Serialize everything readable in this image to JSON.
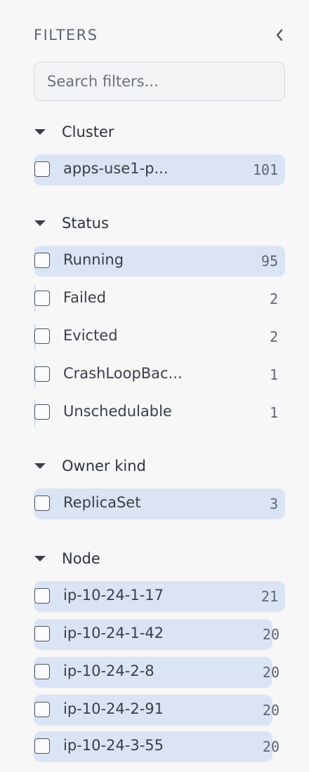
{
  "header": {
    "title": "FILTERS"
  },
  "search": {
    "placeholder": "Search filters..."
  },
  "sections": [
    {
      "title": "Cluster",
      "items": [
        {
          "label": "apps-use1-p...",
          "count": "101",
          "fill": 1.0
        }
      ]
    },
    {
      "title": "Status",
      "items": [
        {
          "label": "Running",
          "count": "95",
          "fill": 1.0
        },
        {
          "label": "Failed",
          "count": "2",
          "fill": 0.02
        },
        {
          "label": "Evicted",
          "count": "2",
          "fill": 0.02
        },
        {
          "label": "CrashLoopBac...",
          "count": "1",
          "fill": 0.01
        },
        {
          "label": "Unschedulable",
          "count": "1",
          "fill": 0.01
        }
      ]
    },
    {
      "title": "Owner kind",
      "items": [
        {
          "label": "ReplicaSet",
          "count": "3",
          "fill": 1.0
        }
      ]
    },
    {
      "title": "Node",
      "items": [
        {
          "label": "ip-10-24-1-17",
          "count": "21",
          "fill": 1.0
        },
        {
          "label": "ip-10-24-1-42",
          "count": "20",
          "fill": 0.95
        },
        {
          "label": "ip-10-24-2-8",
          "count": "20",
          "fill": 0.95
        },
        {
          "label": "ip-10-24-2-91",
          "count": "20",
          "fill": 0.95
        },
        {
          "label": "ip-10-24-3-55",
          "count": "20",
          "fill": 0.95
        }
      ]
    }
  ],
  "icons": {
    "collapse": "chevron-left-icon",
    "section_toggle": "caret-down-icon",
    "checkbox": "checkbox-unchecked"
  },
  "colors": {
    "bar_fill": "#dbe4f5",
    "background": "#f7f7f8"
  }
}
